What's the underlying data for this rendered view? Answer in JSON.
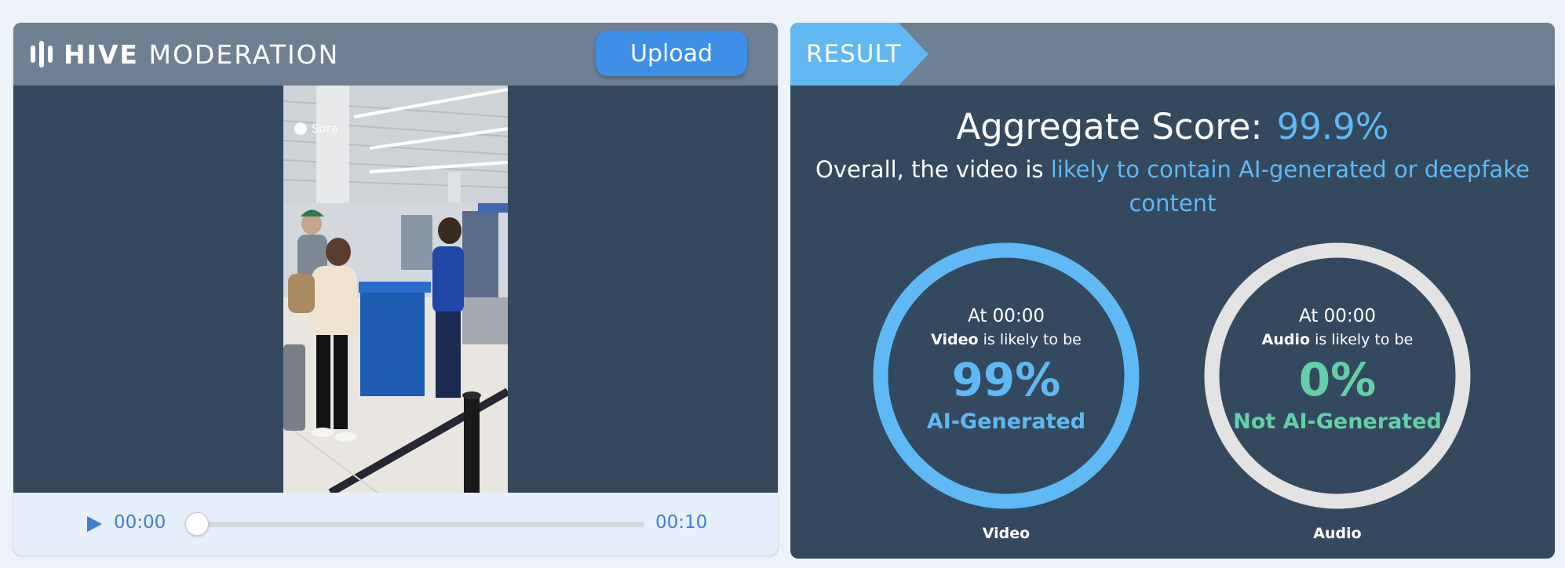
{
  "brand": {
    "bold": "HIVE",
    "light": "MODERATION"
  },
  "upload_label": "Upload",
  "video": {
    "watermark": "Sora"
  },
  "player": {
    "current_time": "00:00",
    "total_time": "00:10",
    "progress": 0
  },
  "result": {
    "tab_label": "RESULT",
    "aggregate_label": "Aggregate Score:",
    "aggregate_value": "99.9%",
    "summary_prefix": "Overall, the video is",
    "summary_highlight": "likely to contain AI-generated or deepfake content"
  },
  "gauges": {
    "video": {
      "at": "At 00:00",
      "subject": "Video",
      "phrase": "is likely to be",
      "percent": "99%",
      "verdict": "AI-Generated",
      "caption": "Video",
      "color": "#5fb9f5",
      "track_color": "#5fb9f5"
    },
    "audio": {
      "at": "At 00:00",
      "subject": "Audio",
      "phrase": "is likely to be",
      "percent": "0%",
      "verdict": "Not AI-Generated",
      "caption": "Audio",
      "color": "#62d0a8",
      "track_color": "#e3e3e3"
    }
  }
}
